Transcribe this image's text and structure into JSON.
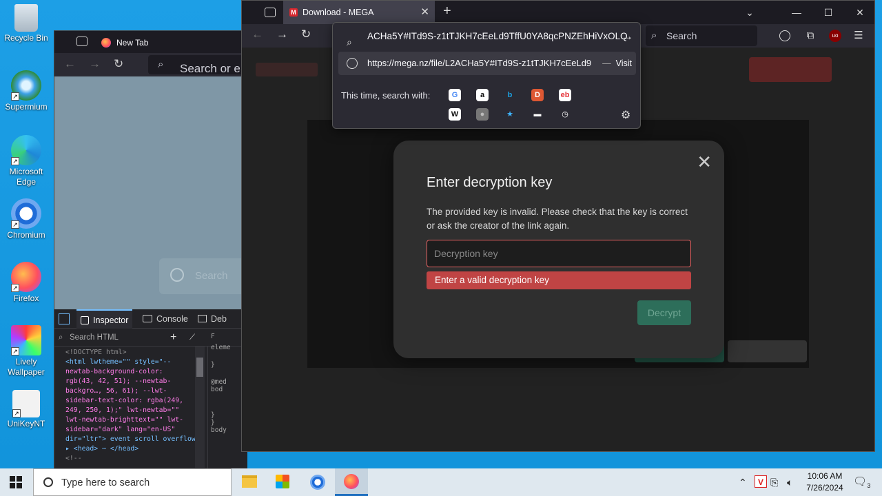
{
  "desktop": {
    "icons": [
      {
        "label": "Recycle Bin",
        "icon": "recycle-bin-icon"
      },
      {
        "label": "Supermium",
        "icon": "supermium-icon"
      },
      {
        "label": "Microsoft Edge",
        "icon": "edge-icon"
      },
      {
        "label": "Chromium",
        "icon": "chromium-icon"
      },
      {
        "label": "Firefox",
        "icon": "firefox-icon"
      },
      {
        "label": "Lively Wallpaper",
        "icon": "lively-wallpaper-icon"
      },
      {
        "label": "UniKeyNT",
        "icon": "unikey-icon"
      }
    ]
  },
  "background_window": {
    "tab_title": "New Tab",
    "url_placeholder": "Search or e",
    "page_search_placeholder": "Search",
    "devtools": {
      "tabs": [
        "Inspector",
        "Console",
        "Deb"
      ],
      "search_placeholder": "Search HTML",
      "code_lines": [
        "<!DOCTYPE html>",
        "<html lwtheme=\"\" style=\"--",
        "newtab-background-color:",
        "rgb(43, 42, 51); --newtab-",
        "backgro…, 56, 61); --lwt-",
        "sidebar-text-color: rgba(249,",
        "249, 250, 1);\" lwt-newtab=\"\"",
        "lwt-newtab-brighttext=\"\" lwt-",
        "sidebar=\"dark\" lang=\"en-US\"",
        "dir=\"ltr\"> event scroll overflow",
        "▸ <head> ⋯ </head>",
        "  <!--"
      ],
      "right_lines": [
        "F",
        "eleme",
        "",
        "}",
        "",
        "@med",
        "bod",
        "",
        "",
        "}",
        "}",
        "body"
      ]
    }
  },
  "main_window": {
    "tab_title": "Download - MEGA",
    "tab_favicon": "M",
    "toolbar_search_placeholder": "Search",
    "url_text": "ACHa5Y#ITd9S-z1tTJKH7cEeLd9TffU0YA8qcPNZEhHiVxOLQ",
    "suggestion_url": "https://mega.nz/file/L2ACHa5Y#ITd9S-z1tTJKH7cEeLd9",
    "suggestion_action": "Visit",
    "suggestion_dash": "—",
    "search_with_label": "This time, search with:",
    "engines_row1": [
      {
        "name": "google-icon",
        "glyph": "G",
        "color": "#4285f4",
        "bg": "#ffffff"
      },
      {
        "name": "amazon-icon",
        "glyph": "a",
        "color": "#111111",
        "bg": "#ffffff"
      },
      {
        "name": "bing-icon",
        "glyph": "b",
        "color": "#1ba1e2",
        "bg": "transparent"
      },
      {
        "name": "duckduckgo-icon",
        "glyph": "D",
        "color": "#ffffff",
        "bg": "#de5833"
      },
      {
        "name": "ebay-icon",
        "glyph": "eb",
        "color": "#e53238",
        "bg": "#ffffff"
      }
    ],
    "engines_row2": [
      {
        "name": "wikipedia-icon",
        "glyph": "W",
        "color": "#111111",
        "bg": "#ffffff"
      },
      {
        "name": "search-engine-icon",
        "glyph": "●",
        "color": "#bbbbbb",
        "bg": "#777777"
      },
      {
        "name": "bookmarks-icon",
        "glyph": "★",
        "color": "#3fb6ff",
        "bg": "transparent"
      },
      {
        "name": "tabs-icon",
        "glyph": "▬",
        "color": "#ffffff",
        "bg": "transparent"
      },
      {
        "name": "history-icon",
        "glyph": "◷",
        "color": "#ffffff",
        "bg": "transparent"
      }
    ]
  },
  "modal": {
    "title": "Enter decryption key",
    "message": "The provided key is invalid. Please check that the key is correct or ask the creator of the link again.",
    "input_placeholder": "Decryption key",
    "error": "Enter a valid decryption key",
    "button": "Decrypt"
  },
  "taskbar": {
    "search_placeholder": "Type here to search",
    "apps": [
      "file-explorer-icon",
      "microsoft-store-icon",
      "chromium-icon",
      "firefox-icon"
    ],
    "time": "10:06 AM",
    "date": "7/26/2024",
    "notification_count": "3"
  }
}
